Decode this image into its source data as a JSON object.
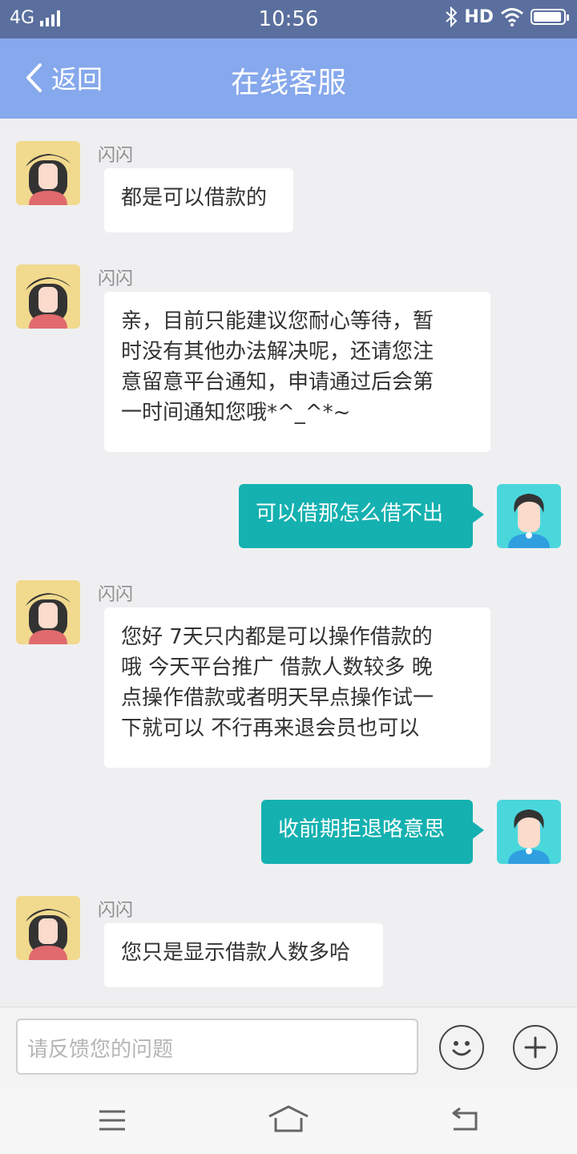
{
  "status_bar": {
    "network": "4G",
    "time": "10:56",
    "hd": "HD"
  },
  "header": {
    "back_label": "返回",
    "title": "在线客服"
  },
  "messages": [
    {
      "from": "agent",
      "sender": "闪闪",
      "text": "都是可以借款的"
    },
    {
      "from": "agent",
      "sender": "闪闪",
      "lines": [
        "亲，目前只能建议您耐心等待，暂",
        "时没有其他办法解决呢，还请您注",
        "意留意平台通知，申请通过后会第",
        "一时间通知您哦*^_^*~"
      ]
    },
    {
      "from": "user",
      "text": "可以借那怎么借不出"
    },
    {
      "from": "agent",
      "sender": "闪闪",
      "lines": [
        "您好 7天只内都是可以操作借款的",
        "哦 今天平台推广 借款人数较多 晚",
        "点操作借款或者明天早点操作试一",
        "下就可以 不行再来退会员也可以"
      ]
    },
    {
      "from": "user",
      "text": "收前期拒退咯意思"
    },
    {
      "from": "agent",
      "sender": "闪闪",
      "text": "您只是显示借款人数多哈"
    }
  ],
  "input": {
    "placeholder": "请反馈您的问题"
  },
  "icons": {
    "emoji": "smiley-icon",
    "plus": "plus-icon",
    "menu": "menu-icon",
    "home": "home-icon",
    "back": "back-icon"
  },
  "colors": {
    "header": "#86a8ec",
    "status_bar": "#5a6f9e",
    "user_bubble": "#14b1b0",
    "background": "#efeff1"
  }
}
